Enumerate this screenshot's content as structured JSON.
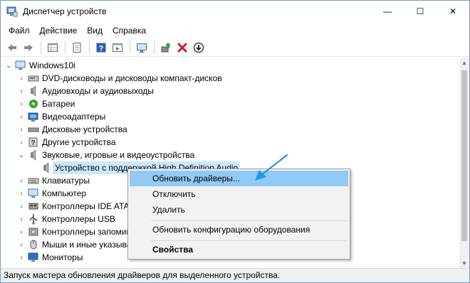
{
  "window": {
    "title": "Диспетчер устройств",
    "controls": {
      "minimize": "—",
      "maximize": "☐",
      "close": "✕"
    }
  },
  "menu": [
    "Файл",
    "Действие",
    "Вид",
    "Справка"
  ],
  "toolbar": {
    "buttons": [
      "back-icon",
      "forward-icon",
      "properties-grid-icon",
      "properties-sheet-icon",
      "help-icon",
      "run-icon",
      "monitor-icon",
      "update-driver-icon",
      "remove-device-icon",
      "download-icon"
    ],
    "colors": {
      "remove": "#d11a2a",
      "update": "#2e9e3b",
      "help": "#2a5db0"
    }
  },
  "tree": {
    "root": "Windows10i",
    "items": [
      {
        "label": "DVD-дисководы и дисководы компакт-дисков",
        "icon": "dvd-icon",
        "expander": "›"
      },
      {
        "label": "Аудиовходы и аудиовыходы",
        "icon": "speaker-icon",
        "expander": "›"
      },
      {
        "label": "Батареи",
        "icon": "battery-icon",
        "expander": "›"
      },
      {
        "label": "Видеоадаптеры",
        "icon": "display-adapter-icon",
        "expander": "›"
      },
      {
        "label": "Дисковые устройства",
        "icon": "disk-icon",
        "expander": "›"
      },
      {
        "label": "Другие устройства",
        "icon": "unknown-device-icon",
        "expander": "›"
      },
      {
        "label": "Звуковые, игровые и видеоустройства",
        "icon": "speaker-icon",
        "expander": "⌄"
      },
      {
        "label": "Устройство с поддержкой High Definition Audio",
        "icon": "speaker-icon",
        "expander": "",
        "selected": true,
        "child": true
      },
      {
        "label": "Клавиатуры",
        "icon": "keyboard-icon",
        "expander": "›"
      },
      {
        "label": "Компьютер",
        "icon": "computer-icon",
        "expander": "›"
      },
      {
        "label": "Контроллеры IDE ATA/ATAPI",
        "icon": "controller-icon",
        "expander": "›"
      },
      {
        "label": "Контроллеры USB",
        "icon": "usb-icon",
        "expander": "›"
      },
      {
        "label": "Контроллеры запоминающих устройств",
        "icon": "storage-icon",
        "expander": "›"
      },
      {
        "label": "Мыши и иные указывающие устройства",
        "icon": "mouse-icon",
        "expander": "›"
      },
      {
        "label": "Мониторы",
        "icon": "monitor-icon",
        "expander": "›"
      }
    ]
  },
  "context_menu": {
    "items": [
      {
        "label": "Обновить драйверы...",
        "highlighted": true
      },
      {
        "label": "Отключить"
      },
      {
        "label": "Удалить"
      },
      {
        "separator": true
      },
      {
        "label": "Обновить конфигурацию оборудования"
      },
      {
        "separator": true
      },
      {
        "label": "Свойства",
        "bold": true
      }
    ],
    "highlight_color": "#91c9f7"
  },
  "status_bar": {
    "text": "Запуск мастера обновления драйверов для выделенного устройства."
  },
  "annotation": {
    "arrow_color": "#1e9be0"
  }
}
